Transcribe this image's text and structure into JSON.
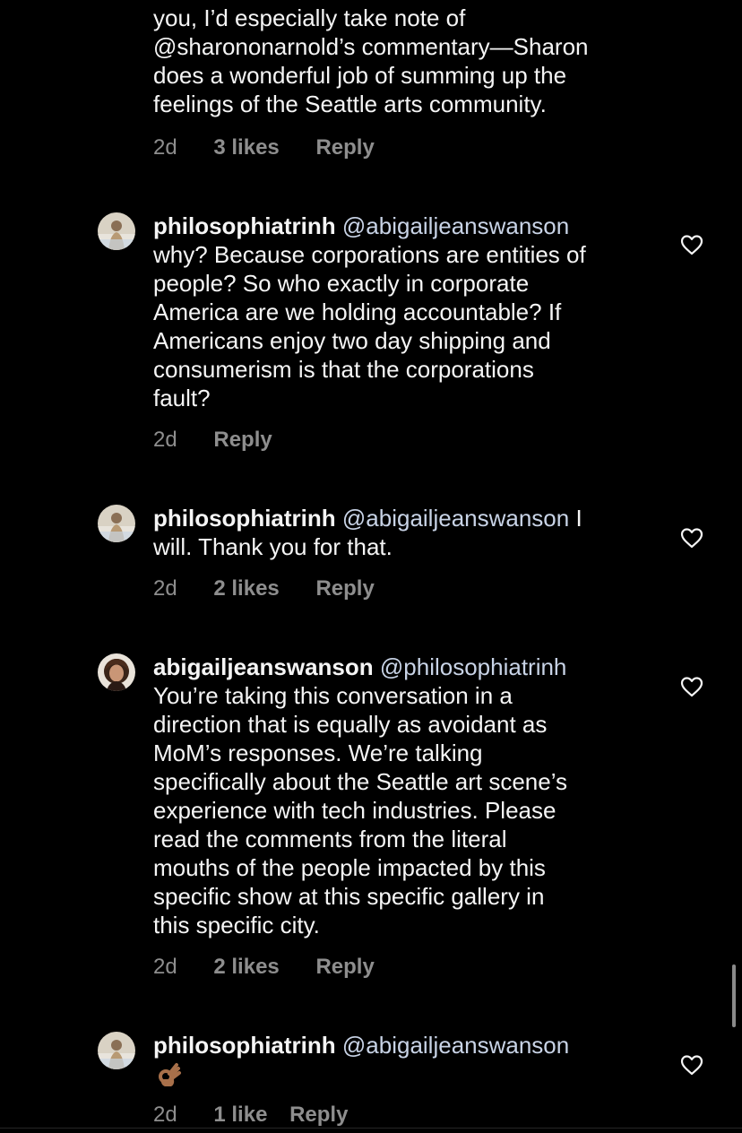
{
  "comments": [
    {
      "id": "c0",
      "username": "",
      "mention": "",
      "text_lines": [
        "you, I’d especially take note of",
        "@sharononarnold’s commentary—Sharon",
        "does a wonderful job of summing up the",
        "feelings of the Seattle arts community."
      ],
      "time": "2d",
      "likes": "3 likes",
      "reply": "Reply"
    },
    {
      "id": "c1",
      "username": "philosophiatrinh",
      "mention": "@abigailjeanswanson",
      "text_lines": [
        "why? Because corporations are entities of",
        "people? So who exactly in corporate",
        "America are we holding accountable? If",
        "Americans enjoy two day shipping and",
        "consumerism is that the corporations",
        "fault?"
      ],
      "time": "2d",
      "likes": "",
      "reply": "Reply",
      "heart_icon": "heart-outline-icon"
    },
    {
      "id": "c2",
      "username": "philosophiatrinh",
      "mention": "@abigailjeanswanson",
      "first_line_tail": "I",
      "text_lines": [
        "will. Thank you for that."
      ],
      "time": "2d",
      "likes": "2 likes",
      "reply": "Reply",
      "heart_icon": "heart-outline-icon"
    },
    {
      "id": "c3",
      "username": "abigailjeanswanson",
      "mention": "@philosophiatrinh",
      "text_lines": [
        "You’re taking this conversation in a",
        "direction that is equally as avoidant as",
        "MoM’s responses. We’re talking",
        "specifically about the Seattle art scene’s",
        "experience with tech industries. Please",
        "read the comments from the literal",
        "mouths of the people impacted by this",
        "specific show at this specific gallery in",
        "this specific city."
      ],
      "time": "2d",
      "likes": "2 likes",
      "reply": "Reply",
      "heart_icon": "heart-outline-icon"
    },
    {
      "id": "c4",
      "username": "philosophiatrinh",
      "mention": "@abigailjeanswanson",
      "emoji": "ok-hand-emoji",
      "time": "2d",
      "likes": "1 like",
      "reply": "Reply",
      "heart_icon": "heart-outline-icon"
    }
  ],
  "colors": {
    "background": "#000000",
    "text": "#f5f5f5",
    "meta": "#8e8e8e",
    "mention": "#c8d3e6"
  }
}
